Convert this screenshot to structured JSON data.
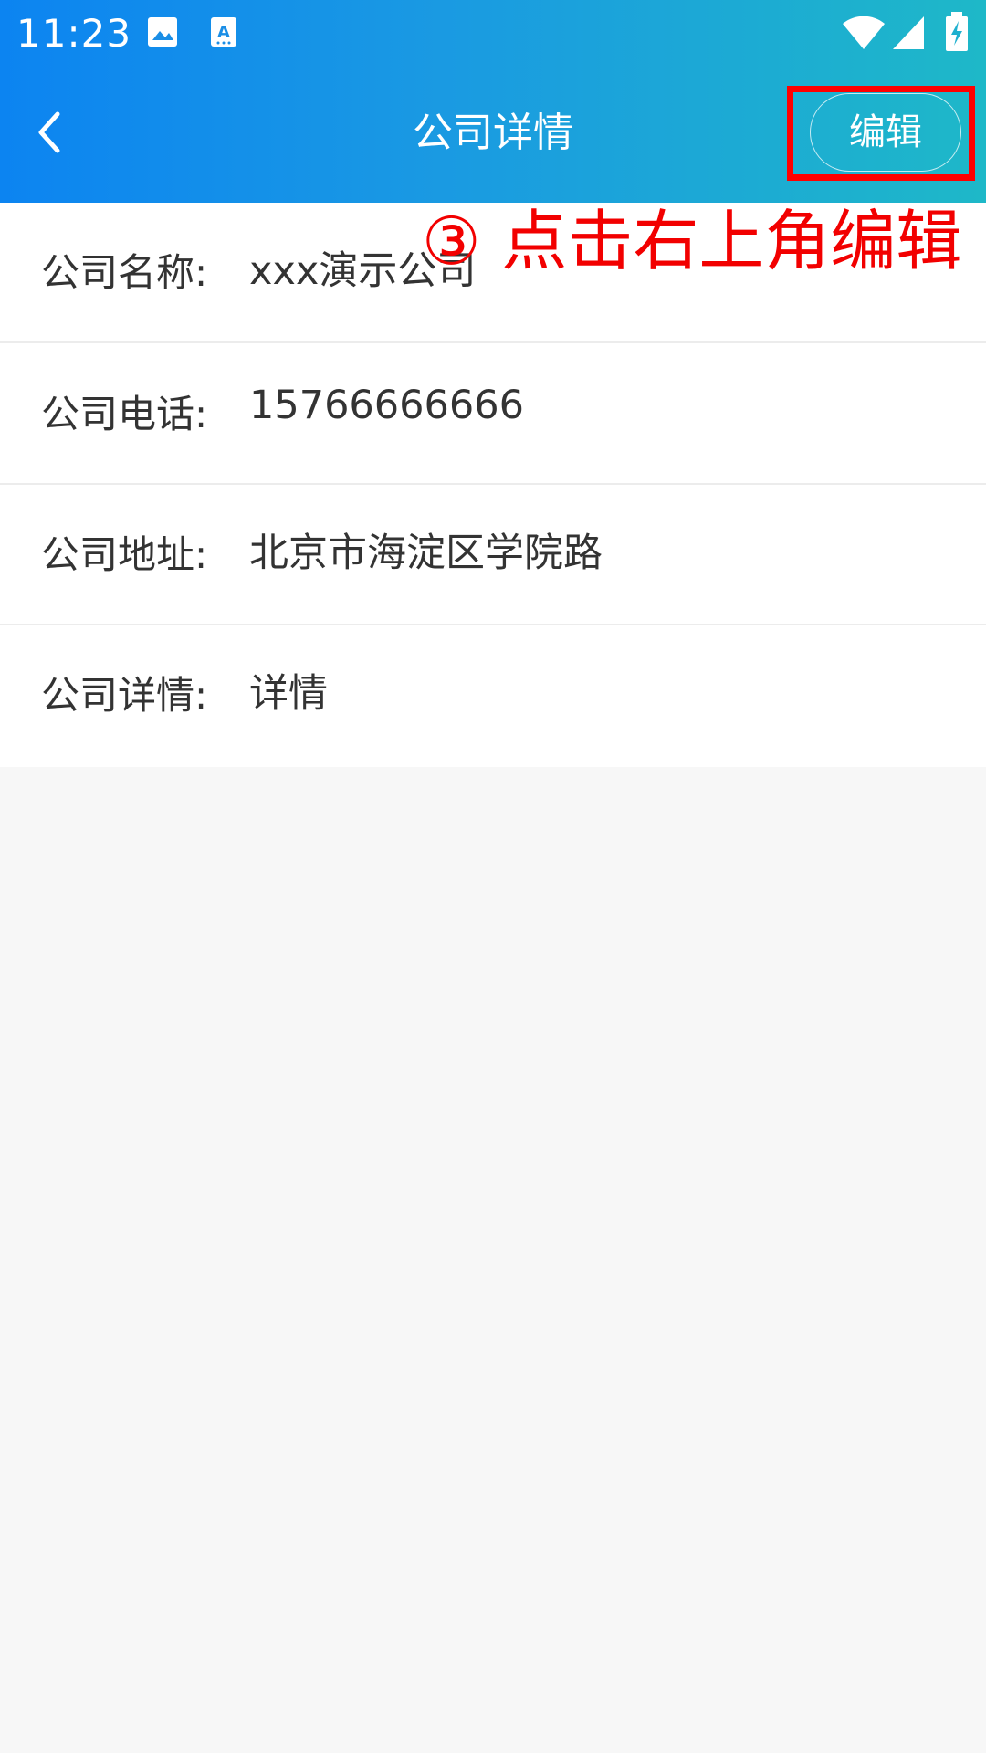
{
  "status_bar": {
    "time": "11:23",
    "icons": [
      "gallery-icon",
      "keyboard-a-icon",
      "wifi-icon",
      "cellular-signal-icon",
      "battery-charging-icon"
    ]
  },
  "header": {
    "title": "公司详情",
    "edit_label": "编辑",
    "back_icon": "chevron-left-icon",
    "gradient_colors": [
      "#0c84f1",
      "#1eb8c8"
    ]
  },
  "annotation": {
    "text": "③ 点击右上角编辑",
    "color": "#ff0000"
  },
  "details": [
    {
      "label": "公司名称:",
      "value": "xxx演示公司"
    },
    {
      "label": "公司电话:",
      "value": "15766666666"
    },
    {
      "label": "公司地址:",
      "value": "北京市海淀区学院路"
    },
    {
      "label": "公司详情:",
      "value": "详情"
    }
  ]
}
